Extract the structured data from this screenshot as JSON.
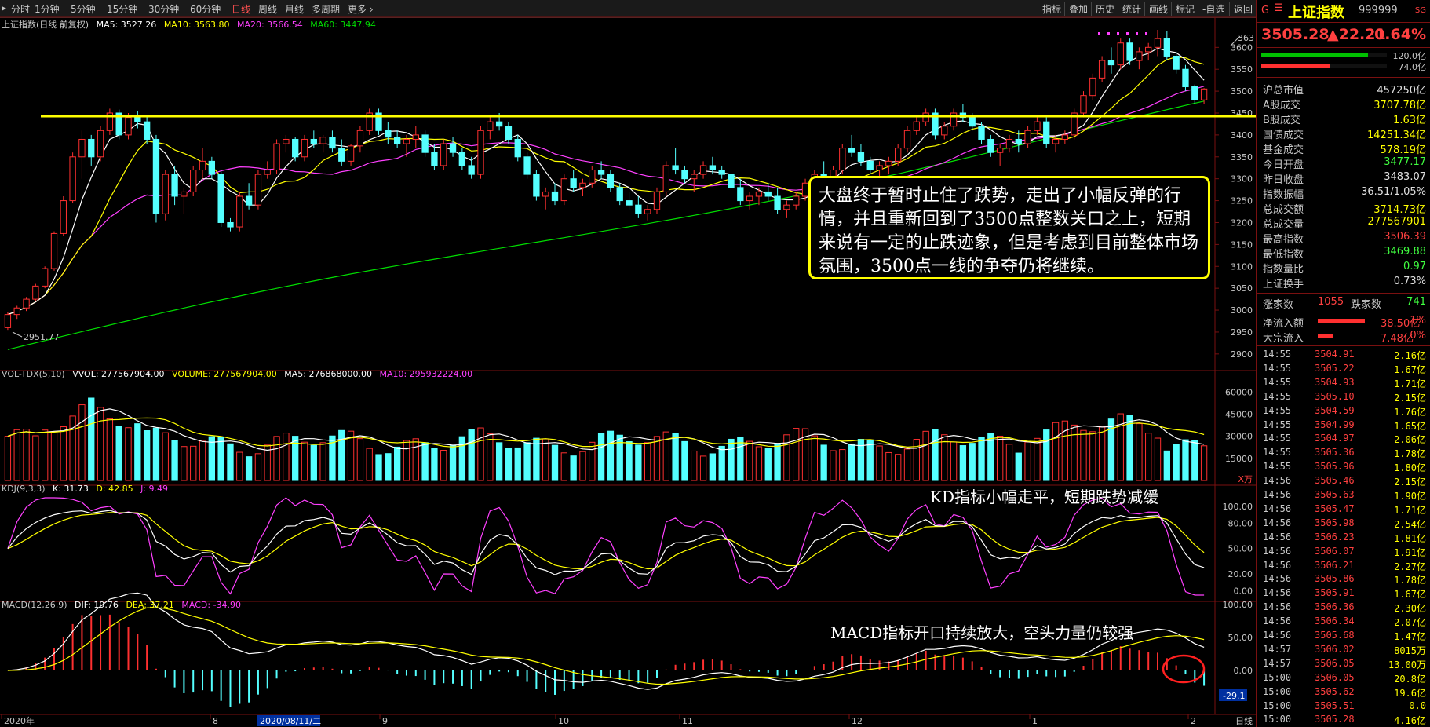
{
  "toolbar": {
    "periods": [
      "分时",
      "1分钟",
      "5分钟",
      "15分钟",
      "30分钟",
      "60分钟",
      "日线",
      "周线",
      "月线",
      "多周期",
      "更多"
    ],
    "active_period": "日线",
    "right_buttons": [
      "指标",
      "叠加",
      "历史",
      "统计",
      "画线",
      "标记",
      "-自选",
      "返回"
    ]
  },
  "main_header": {
    "name": "上证指数(日线 前复权)",
    "ma5": "MA5: 3527.26",
    "ma10": "MA10: 3563.80",
    "ma20": "MA20: 3566.54",
    "ma60": "MA60: 3447.94"
  },
  "price_axis": [
    "3600",
    "3550",
    "3500",
    "3450",
    "3400",
    "3350",
    "3300",
    "3250",
    "3200",
    "3150",
    "3100",
    "3050",
    "3000",
    "2950",
    "2900"
  ],
  "high_label": "3637.10",
  "low_label": "2951.77",
  "vol_header": {
    "name": "VOL-TDX(5,10)",
    "vvol": "VVOL: 277567904.00",
    "volume": "VOLUME: 277567904.00",
    "ma5": "MA5: 276868000.00",
    "ma10": "MA10: 295932224.00"
  },
  "vol_axis": [
    "60000",
    "45000",
    "30000",
    "15000"
  ],
  "vol_unit": "X万",
  "kdj_header": {
    "name": "KDJ(9,3,3)",
    "k": "K: 31.73",
    "d": "D: 42.85",
    "j": "J: 9.49"
  },
  "kdj_axis": [
    "100.00",
    "80.00",
    "50.00",
    "20.00",
    "0.00"
  ],
  "macd_header": {
    "name": "MACD(12,26,9)",
    "dif": "DIF: 19.76",
    "dea": "DEA: 37.21",
    "macd": "MACD: -34.90"
  },
  "macd_axis": [
    "100.00",
    "50.00",
    "0.00"
  ],
  "macd_value_tag": "-29.1",
  "date_axis": {
    "year": "2020年",
    "m8": "8",
    "sel": "2020/08/11/二",
    "m9": "9",
    "m10": "10",
    "m11": "11",
    "m12": "12",
    "m1": "1",
    "m2": "2",
    "corner": "日线"
  },
  "annotations": {
    "box": "大盘终于暂时止住了跌势，走出了小幅反弹的行情，并且重新回到了3500点整数关口之上，短期来说有一定的止跌迹象，但是考虑到目前整体市场氛围，3500点一线的争夺仍将继续。",
    "kd": "KD指标小幅走平，短期跌势减缓",
    "macd": "MACD指标开口持续放大，空头力量仍较强"
  },
  "side": {
    "tag": "G",
    "title": "上证指数",
    "code": "999999",
    "corner": "SG",
    "price": "3505.28",
    "change": "▲22.21",
    "pct": "0.64%",
    "bar1": "120.0亿",
    "bar2": "74.0亿",
    "bar1_fill": 0.85,
    "bar2_fill": 0.55,
    "stats": [
      {
        "label": "沪总市值",
        "value": "457250亿",
        "color": "#e0e0e0"
      },
      {
        "label": "A股成交",
        "value": "3707.78亿",
        "color": "#ffff00"
      },
      {
        "label": "B股成交",
        "value": "1.63亿",
        "color": "#ffff00"
      },
      {
        "label": "国债成交",
        "value": "14251.34亿",
        "color": "#ffff00"
      },
      {
        "label": "基金成交",
        "value": "578.19亿",
        "color": "#ffff00"
      },
      {
        "label": "今日开盘",
        "value": "3477.17",
        "color": "#40ff40"
      },
      {
        "label": "昨日收盘",
        "value": "3483.07",
        "color": "#e0e0e0"
      },
      {
        "label": "指数振幅",
        "value": "36.51/1.05%",
        "color": "#e0e0e0"
      },
      {
        "label": "总成交额",
        "value": "3714.73亿",
        "color": "#ffff00"
      },
      {
        "label": "总成交量",
        "value": "277567901",
        "color": "#ffff00"
      },
      {
        "label": "最高指数",
        "value": "3506.39",
        "color": "#ff4040"
      },
      {
        "label": "最低指数",
        "value": "3469.88",
        "color": "#40ff40"
      },
      {
        "label": "指数量比",
        "value": "0.97",
        "color": "#40ff40"
      },
      {
        "label": "上证换手",
        "value": "0.73%",
        "color": "#e0e0e0"
      }
    ],
    "up_label": "涨家数",
    "up_count": "1055",
    "down_label": "跌家数",
    "down_count": "741",
    "flow": [
      {
        "label": "净流入额",
        "value": "38.50亿",
        "pct": "1%",
        "fill": 0.75
      },
      {
        "label": "大宗流入",
        "value": "7.48亿",
        "pct": "0%",
        "fill": 0.25
      }
    ],
    "ticks": [
      [
        "14:55",
        "3504.91",
        "2.16亿"
      ],
      [
        "14:55",
        "3505.22",
        "1.67亿"
      ],
      [
        "14:55",
        "3504.93",
        "1.71亿"
      ],
      [
        "14:55",
        "3505.10",
        "2.15亿"
      ],
      [
        "14:55",
        "3504.59",
        "1.76亿"
      ],
      [
        "14:55",
        "3504.99",
        "1.65亿"
      ],
      [
        "14:55",
        "3504.97",
        "2.06亿"
      ],
      [
        "14:55",
        "3505.36",
        "1.78亿"
      ],
      [
        "14:55",
        "3505.96",
        "1.80亿"
      ],
      [
        "14:56",
        "3505.46",
        "2.15亿"
      ],
      [
        "14:56",
        "3505.63",
        "1.90亿"
      ],
      [
        "14:56",
        "3505.47",
        "1.71亿"
      ],
      [
        "14:56",
        "3505.98",
        "2.54亿"
      ],
      [
        "14:56",
        "3506.23",
        "1.81亿"
      ],
      [
        "14:56",
        "3506.07",
        "1.91亿"
      ],
      [
        "14:56",
        "3506.21",
        "2.27亿"
      ],
      [
        "14:56",
        "3505.86",
        "1.78亿"
      ],
      [
        "14:56",
        "3505.91",
        "1.67亿"
      ],
      [
        "14:56",
        "3506.36",
        "2.30亿"
      ],
      [
        "14:56",
        "3506.34",
        "2.07亿"
      ],
      [
        "14:56",
        "3505.68",
        "1.47亿"
      ],
      [
        "14:57",
        "3506.02",
        "8015万"
      ],
      [
        "14:57",
        "3506.05",
        "13.00万"
      ],
      [
        "15:00",
        "3506.05",
        "20.8亿"
      ],
      [
        "15:00",
        "3505.62",
        "19.6亿"
      ],
      [
        "15:00",
        "3505.51",
        "0.0"
      ],
      [
        "15:00",
        "3505.28",
        "4.16亿"
      ]
    ]
  },
  "colors": {
    "up": "#ff3030",
    "down": "#54ffff",
    "ma5": "#ffffff",
    "ma10": "#ffff00",
    "ma20": "#ff40ff",
    "ma60": "#00dd00",
    "accent": "#ffff00"
  },
  "chart_data": {
    "type": "candlestick",
    "x": "trading days 2020-06 to 2021-02",
    "ylim": [
      2880,
      3640
    ],
    "ohlc": [
      [
        2960,
        2995,
        2955,
        2990
      ],
      [
        2990,
        3010,
        2980,
        3005
      ],
      [
        3005,
        3030,
        2998,
        3025
      ],
      [
        3025,
        3060,
        3020,
        3055
      ],
      [
        3055,
        3100,
        3050,
        3095
      ],
      [
        3095,
        3180,
        3090,
        3175
      ],
      [
        3175,
        3260,
        3170,
        3250
      ],
      [
        3250,
        3360,
        3245,
        3350
      ],
      [
        3350,
        3410,
        3300,
        3390
      ],
      [
        3390,
        3400,
        3330,
        3350
      ],
      [
        3350,
        3420,
        3340,
        3410
      ],
      [
        3410,
        3460,
        3400,
        3450
      ],
      [
        3450,
        3458,
        3390,
        3400
      ],
      [
        3400,
        3450,
        3390,
        3440
      ],
      [
        3440,
        3455,
        3415,
        3430
      ],
      [
        3430,
        3445,
        3380,
        3390
      ],
      [
        3390,
        3400,
        3200,
        3220
      ],
      [
        3220,
        3320,
        3205,
        3310
      ],
      [
        3310,
        3330,
        3240,
        3260
      ],
      [
        3260,
        3280,
        3220,
        3270
      ],
      [
        3270,
        3330,
        3260,
        3320
      ],
      [
        3320,
        3370,
        3300,
        3340
      ],
      [
        3340,
        3350,
        3300,
        3310
      ],
      [
        3310,
        3320,
        3190,
        3200
      ],
      [
        3200,
        3210,
        3180,
        3190
      ],
      [
        3190,
        3270,
        3180,
        3260
      ],
      [
        3260,
        3290,
        3230,
        3240
      ],
      [
        3240,
        3320,
        3230,
        3310
      ],
      [
        3310,
        3340,
        3300,
        3320
      ],
      [
        3320,
        3390,
        3310,
        3380
      ],
      [
        3380,
        3400,
        3360,
        3390
      ],
      [
        3390,
        3395,
        3340,
        3350
      ],
      [
        3350,
        3400,
        3340,
        3390
      ],
      [
        3390,
        3410,
        3370,
        3380
      ],
      [
        3380,
        3400,
        3360,
        3395
      ],
      [
        3395,
        3410,
        3360,
        3370
      ],
      [
        3370,
        3390,
        3330,
        3340
      ],
      [
        3340,
        3380,
        3330,
        3375
      ],
      [
        3375,
        3420,
        3360,
        3410
      ],
      [
        3410,
        3460,
        3400,
        3450
      ],
      [
        3450,
        3460,
        3400,
        3410
      ],
      [
        3410,
        3430,
        3380,
        3395
      ],
      [
        3395,
        3410,
        3370,
        3380
      ],
      [
        3380,
        3400,
        3350,
        3390
      ],
      [
        3390,
        3420,
        3370,
        3400
      ],
      [
        3400,
        3410,
        3350,
        3360
      ],
      [
        3360,
        3380,
        3320,
        3330
      ],
      [
        3330,
        3390,
        3320,
        3380
      ],
      [
        3380,
        3395,
        3350,
        3360
      ],
      [
        3360,
        3370,
        3320,
        3330
      ],
      [
        3330,
        3350,
        3300,
        3310
      ],
      [
        3310,
        3420,
        3300,
        3410
      ],
      [
        3410,
        3440,
        3390,
        3430
      ],
      [
        3430,
        3450,
        3410,
        3420
      ],
      [
        3420,
        3430,
        3380,
        3390
      ],
      [
        3390,
        3400,
        3340,
        3350
      ],
      [
        3350,
        3360,
        3300,
        3310
      ],
      [
        3310,
        3320,
        3250,
        3260
      ],
      [
        3260,
        3280,
        3230,
        3270
      ],
      [
        3270,
        3290,
        3240,
        3250
      ],
      [
        3250,
        3310,
        3240,
        3300
      ],
      [
        3300,
        3320,
        3270,
        3280
      ],
      [
        3280,
        3300,
        3260,
        3290
      ],
      [
        3290,
        3330,
        3280,
        3320
      ],
      [
        3320,
        3340,
        3300,
        3310
      ],
      [
        3310,
        3320,
        3270,
        3280
      ],
      [
        3280,
        3290,
        3240,
        3250
      ],
      [
        3250,
        3270,
        3230,
        3240
      ],
      [
        3240,
        3260,
        3210,
        3220
      ],
      [
        3220,
        3240,
        3205,
        3230
      ],
      [
        3230,
        3280,
        3220,
        3270
      ],
      [
        3270,
        3340,
        3260,
        3330
      ],
      [
        3330,
        3370,
        3310,
        3320
      ],
      [
        3320,
        3330,
        3290,
        3300
      ],
      [
        3300,
        3320,
        3270,
        3310
      ],
      [
        3310,
        3340,
        3300,
        3330
      ],
      [
        3330,
        3350,
        3310,
        3320
      ],
      [
        3320,
        3330,
        3300,
        3310
      ],
      [
        3310,
        3320,
        3270,
        3280
      ],
      [
        3280,
        3300,
        3240,
        3250
      ],
      [
        3250,
        3270,
        3230,
        3260
      ],
      [
        3260,
        3280,
        3240,
        3270
      ],
      [
        3270,
        3290,
        3250,
        3260
      ],
      [
        3260,
        3280,
        3220,
        3230
      ],
      [
        3230,
        3250,
        3210,
        3240
      ],
      [
        3240,
        3270,
        3230,
        3260
      ],
      [
        3260,
        3300,
        3250,
        3290
      ],
      [
        3290,
        3320,
        3280,
        3310
      ],
      [
        3310,
        3340,
        3290,
        3300
      ],
      [
        3300,
        3330,
        3290,
        3320
      ],
      [
        3320,
        3380,
        3310,
        3370
      ],
      [
        3370,
        3400,
        3350,
        3360
      ],
      [
        3360,
        3380,
        3330,
        3340
      ],
      [
        3340,
        3350,
        3310,
        3320
      ],
      [
        3320,
        3340,
        3300,
        3330
      ],
      [
        3330,
        3350,
        3310,
        3340
      ],
      [
        3340,
        3380,
        3330,
        3370
      ],
      [
        3370,
        3420,
        3360,
        3410
      ],
      [
        3410,
        3440,
        3400,
        3430
      ],
      [
        3430,
        3460,
        3420,
        3450
      ],
      [
        3450,
        3460,
        3390,
        3400
      ],
      [
        3400,
        3430,
        3390,
        3420
      ],
      [
        3420,
        3460,
        3410,
        3450
      ],
      [
        3450,
        3470,
        3430,
        3440
      ],
      [
        3440,
        3450,
        3410,
        3420
      ],
      [
        3420,
        3430,
        3380,
        3390
      ],
      [
        3390,
        3400,
        3350,
        3360
      ],
      [
        3360,
        3380,
        3330,
        3370
      ],
      [
        3370,
        3400,
        3360,
        3390
      ],
      [
        3390,
        3410,
        3360,
        3380
      ],
      [
        3380,
        3420,
        3370,
        3410
      ],
      [
        3410,
        3440,
        3400,
        3430
      ],
      [
        3430,
        3440,
        3370,
        3380
      ],
      [
        3380,
        3400,
        3360,
        3390
      ],
      [
        3390,
        3410,
        3380,
        3400
      ],
      [
        3400,
        3460,
        3390,
        3450
      ],
      [
        3450,
        3500,
        3440,
        3490
      ],
      [
        3490,
        3540,
        3480,
        3530
      ],
      [
        3530,
        3580,
        3520,
        3570
      ],
      [
        3570,
        3600,
        3540,
        3560
      ],
      [
        3560,
        3620,
        3550,
        3610
      ],
      [
        3610,
        3620,
        3560,
        3570
      ],
      [
        3570,
        3600,
        3550,
        3590
      ],
      [
        3590,
        3610,
        3570,
        3600
      ],
      [
        3600,
        3640,
        3580,
        3620
      ],
      [
        3620,
        3637,
        3570,
        3580
      ],
      [
        3580,
        3590,
        3540,
        3550
      ],
      [
        3550,
        3560,
        3500,
        3510
      ],
      [
        3510,
        3515,
        3470,
        3480
      ],
      [
        3480,
        3507,
        3470,
        3505
      ]
    ]
  }
}
